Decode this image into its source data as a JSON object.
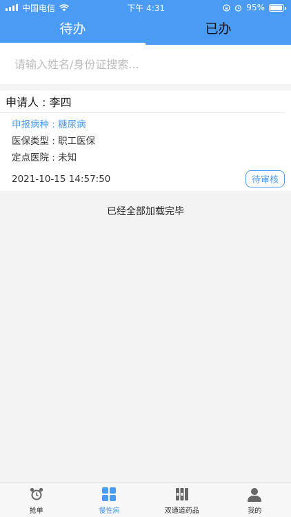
{
  "status": {
    "carrier": "中国电信",
    "time": "下午 4:31",
    "battery": "95%",
    "battery_level": 0.95
  },
  "tabs": [
    {
      "label": "待办",
      "active": true
    },
    {
      "label": "已办",
      "active": false
    }
  ],
  "search": {
    "placeholder": "请输入姓名/身份证搜索...",
    "value": ""
  },
  "records": [
    {
      "applicant": "申请人 : 李四",
      "disease": "申报病种 : 糖尿病",
      "insurance": "医保类型 : 职工医保",
      "hospital": "定点医院 : 未知",
      "datetime": "2021-10-15 14:57:50",
      "status": "待审核"
    }
  ],
  "list_end": "已经全部加载完毕",
  "bottom_nav": [
    {
      "label": "抢单",
      "icon": "alarm-clock-icon"
    },
    {
      "label": "慢性病",
      "icon": "grid-icon",
      "active": true
    },
    {
      "label": "双通道药品",
      "icon": "medicine-icon"
    },
    {
      "label": "我的",
      "icon": "user-icon"
    }
  ],
  "colors": {
    "accent": "#4a9bf3",
    "background": "#f3f3f3"
  }
}
